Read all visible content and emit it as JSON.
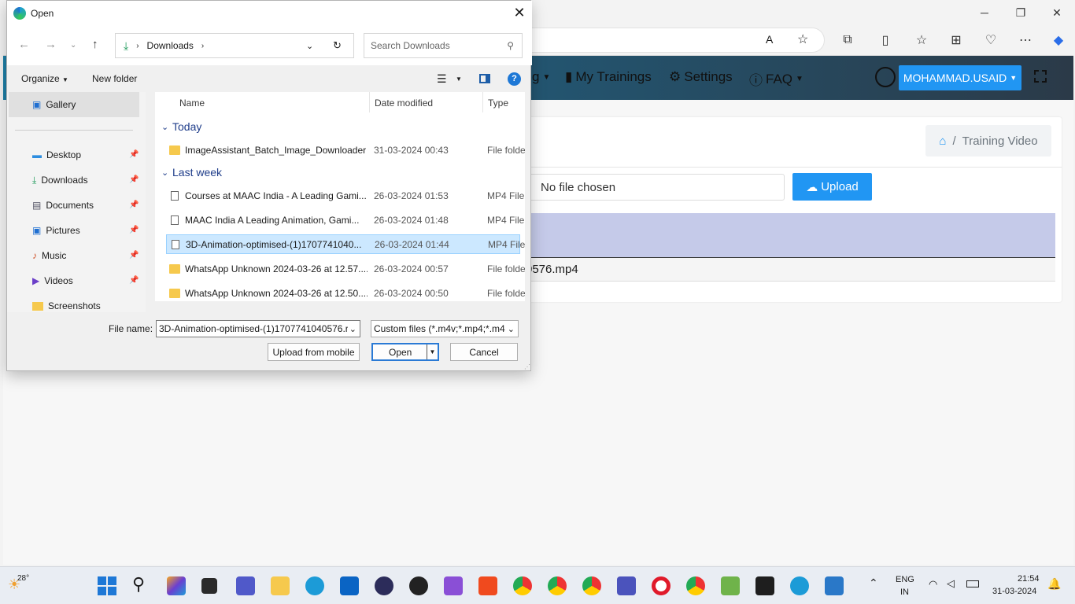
{
  "browser": {
    "minimize": "─",
    "maximize": "❐",
    "close": "✕"
  },
  "site": {
    "nav_items": [
      "g",
      "My Trainings",
      "Settings",
      "FAQ"
    ],
    "user_label": "MOHAMMAD.USAID",
    "breadcrumb_sep": "/",
    "breadcrumb_page": "Training Video",
    "file_status": "No file chosen",
    "upload_label": "Upload",
    "row_file": "0576.mp4"
  },
  "dialog": {
    "title": "Open",
    "path": "Downloads",
    "search_placeholder": "Search Downloads",
    "organize": "Organize",
    "new_folder": "New folder",
    "nav_items": [
      {
        "label": "Gallery",
        "pinned": false
      },
      {
        "label": "Desktop",
        "pinned": true
      },
      {
        "label": "Downloads",
        "pinned": true
      },
      {
        "label": "Documents",
        "pinned": true
      },
      {
        "label": "Pictures",
        "pinned": true
      },
      {
        "label": "Music",
        "pinned": true
      },
      {
        "label": "Videos",
        "pinned": true
      },
      {
        "label": "Screenshots",
        "pinned": false
      }
    ],
    "columns": {
      "name": "Name",
      "date": "Date modified",
      "type": "Type"
    },
    "groups": {
      "today": "Today",
      "last_week": "Last week"
    },
    "files": [
      {
        "name": "ImageAssistant_Batch_Image_Downloader",
        "date": "31-03-2024 00:43",
        "type": "File folder"
      },
      {
        "name": "Courses at MAAC India - A Leading Gami...",
        "date": "26-03-2024 01:53",
        "type": "MP4 File"
      },
      {
        "name": "MAAC India  A Leading Animation, Gami...",
        "date": "26-03-2024 01:48",
        "type": "MP4 File"
      },
      {
        "name": "3D-Animation-optimised-(1)1707741040...",
        "date": "26-03-2024 01:44",
        "type": "MP4 File"
      },
      {
        "name": "WhatsApp Unknown 2024-03-26 at 12.57....",
        "date": "26-03-2024 00:57",
        "type": "File folder"
      },
      {
        "name": "WhatsApp Unknown 2024-03-26 at 12.50....",
        "date": "26-03-2024 00:50",
        "type": "File folder"
      }
    ],
    "filename_label": "File name:",
    "filename_value": "3D-Animation-optimised-(1)1707741040576.r",
    "filter_value": "Custom files (*.m4v;*.mp4;*.m4",
    "upload_mobile": "Upload from mobile",
    "open": "Open",
    "cancel": "Cancel"
  },
  "taskbar": {
    "weather": "28°",
    "lang1": "ENG",
    "lang2": "IN",
    "time": "21:54",
    "date": "31-03-2024"
  }
}
